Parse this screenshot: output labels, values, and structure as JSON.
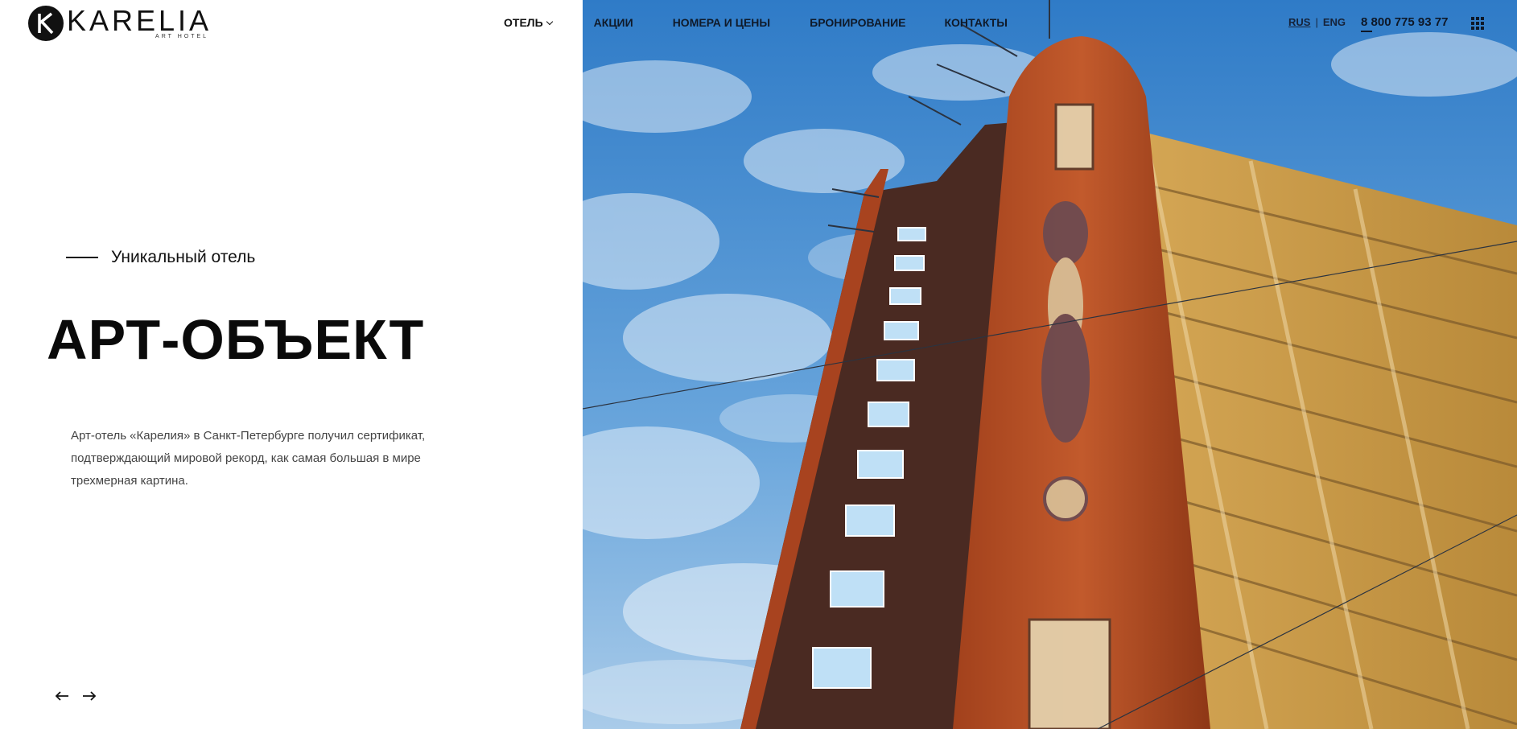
{
  "logo": {
    "name": "KARELIA",
    "subtitle": "ART HOTEL"
  },
  "nav": {
    "items": [
      {
        "label": "ОТЕЛЬ",
        "has_dropdown": true
      },
      {
        "label": "АКЦИИ"
      },
      {
        "label": "НОМЕРА И ЦЕНЫ"
      },
      {
        "label": "БРОНИРОВАНИЕ"
      },
      {
        "label": "КОНТАКТЫ"
      }
    ]
  },
  "lang": {
    "active": "RUS",
    "separator": "|",
    "other": "ENG"
  },
  "phone": "8 800 775 93 77",
  "menu_icon": "grid-menu-icon",
  "hero": {
    "eyebrow": "Уникальный отель",
    "headline": "АРТ-ОБЪЕКТ",
    "description": "Арт-отель «Карелия» в Санкт-Петербурге получил сертификат, подтверждающий мировой рекорд, как самая большая в мире трехмерная картина."
  },
  "slider": {
    "prev_icon": "arrow-left-icon",
    "next_icon": "arrow-right-icon"
  },
  "colors": {
    "text": "#111111",
    "sky": "#3f86c9",
    "brick": "#b14a22",
    "dark_brick": "#4d2a20"
  }
}
